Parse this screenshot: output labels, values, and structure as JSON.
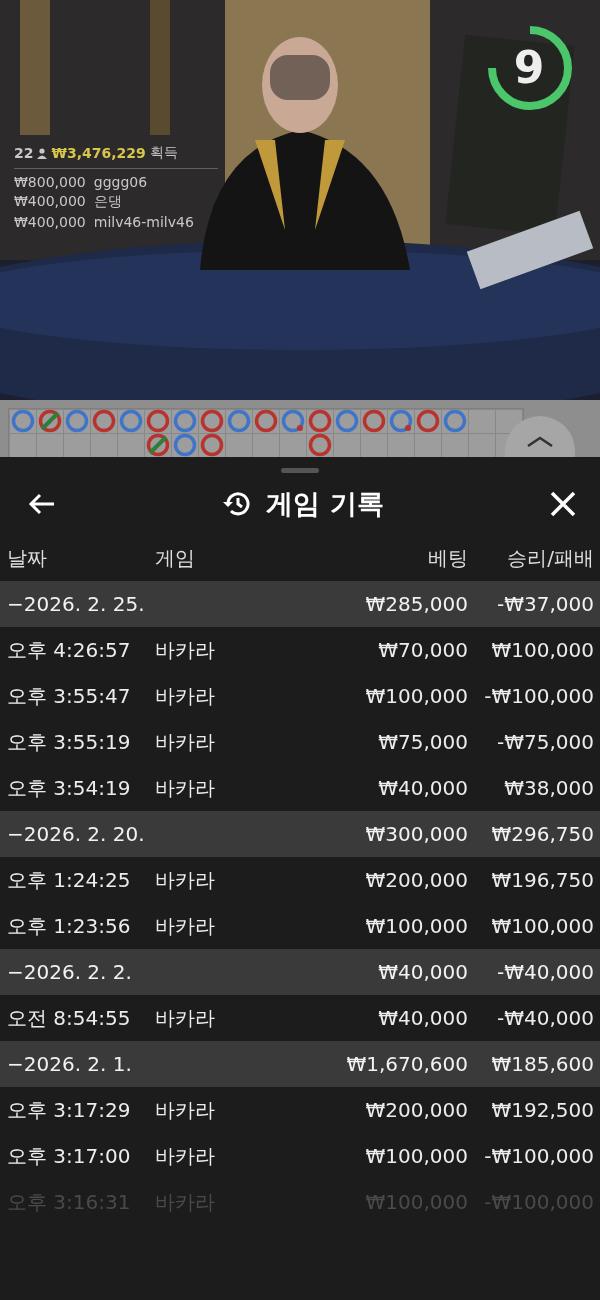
{
  "winners": {
    "count": "22",
    "total": "₩3,476,229",
    "suffix": "획득",
    "rows": [
      {
        "amount": "₩800,000",
        "name": "gggg06"
      },
      {
        "amount": "₩400,000",
        "name": "은댕"
      },
      {
        "amount": "₩400,000",
        "name": "milv46-milv46"
      }
    ]
  },
  "timer": {
    "text": "9",
    "level": 0.75
  },
  "bead_road": [
    {
      "cells": [
        {
          "kind": "circle",
          "color": "#3f74c8",
          "tie": false,
          "dot": false
        },
        {
          "kind": "circle",
          "color": "#b8322e",
          "tie": true,
          "dot": false
        },
        {
          "kind": "circle",
          "color": "#3f74c8",
          "tie": false,
          "dot": false
        },
        {
          "kind": "circle",
          "color": "#b8322e",
          "tie": false,
          "dot": false
        },
        {
          "kind": "circle",
          "color": "#3f74c8",
          "tie": false,
          "dot": false
        },
        {
          "kind": "circle",
          "color": "#b8322e",
          "tie": false,
          "dot": false
        },
        {
          "kind": "circle",
          "color": "#3f74c8",
          "tie": false,
          "dot": false
        },
        {
          "kind": "circle",
          "color": "#b8322e",
          "tie": false,
          "dot": false
        },
        {
          "kind": "circle",
          "color": "#3f74c8",
          "tie": false,
          "dot": false
        },
        {
          "kind": "circle",
          "color": "#b8322e",
          "tie": false,
          "dot": false
        },
        {
          "kind": "circle",
          "color": "#3f74c8",
          "tie": false,
          "dot": true
        },
        {
          "kind": "circle",
          "color": "#b8322e",
          "tie": false,
          "dot": false
        },
        {
          "kind": "circle",
          "color": "#3f74c8",
          "tie": false,
          "dot": false
        },
        {
          "kind": "circle",
          "color": "#b8322e",
          "tie": false,
          "dot": false
        },
        {
          "kind": "circle",
          "color": "#3f74c8",
          "tie": false,
          "dot": true
        },
        {
          "kind": "circle",
          "color": "#b8322e",
          "tie": false,
          "dot": false
        },
        {
          "kind": "circle",
          "color": "#3f74c8",
          "tie": false,
          "dot": false
        }
      ]
    },
    {
      "cells": [
        {
          "kind": "empty"
        },
        {
          "kind": "empty"
        },
        {
          "kind": "empty"
        },
        {
          "kind": "empty"
        },
        {
          "kind": "empty"
        },
        {
          "kind": "circle",
          "color": "#b8322e",
          "tie": true,
          "dot": false
        },
        {
          "kind": "circle",
          "color": "#3f74c8",
          "tie": false,
          "dot": false
        },
        {
          "kind": "circle",
          "color": "#b8322e",
          "tie": false,
          "dot": false
        },
        {
          "kind": "empty"
        },
        {
          "kind": "empty"
        },
        {
          "kind": "empty"
        },
        {
          "kind": "circle",
          "color": "#b8322e",
          "tie": false,
          "dot": false
        }
      ]
    }
  ],
  "sheet": {
    "title": "게임 기록",
    "columns": [
      "날짜",
      "게임",
      "베팅",
      "승리/패배"
    ],
    "rows": [
      {
        "kind": "date",
        "date": "−2026. 2. 25.",
        "bet": "₩285,000",
        "result": "-₩37,000"
      },
      {
        "kind": "game",
        "date": "오후 4:26:57",
        "game": "바카라",
        "bet": "₩70,000",
        "result": "₩100,000",
        "faded": false
      },
      {
        "kind": "game",
        "date": "오후 3:55:47",
        "game": "바카라",
        "bet": "₩100,000",
        "result": "-₩100,000",
        "faded": false
      },
      {
        "kind": "game",
        "date": "오후 3:55:19",
        "game": "바카라",
        "bet": "₩75,000",
        "result": "-₩75,000",
        "faded": false
      },
      {
        "kind": "game",
        "date": "오후 3:54:19",
        "game": "바카라",
        "bet": "₩40,000",
        "result": "₩38,000",
        "faded": false
      },
      {
        "kind": "date",
        "date": "−2026. 2. 20.",
        "bet": "₩300,000",
        "result": "₩296,750"
      },
      {
        "kind": "game",
        "date": "오후 1:24:25",
        "game": "바카라",
        "bet": "₩200,000",
        "result": "₩196,750",
        "faded": false
      },
      {
        "kind": "game",
        "date": "오후 1:23:56",
        "game": "바카라",
        "bet": "₩100,000",
        "result": "₩100,000",
        "faded": false
      },
      {
        "kind": "date",
        "date": "−2026. 2. 2.",
        "bet": "₩40,000",
        "result": "-₩40,000"
      },
      {
        "kind": "game",
        "date": "오전 8:54:55",
        "game": "바카라",
        "bet": "₩40,000",
        "result": "-₩40,000",
        "faded": false
      },
      {
        "kind": "date",
        "date": "−2026. 2. 1.",
        "bet": "₩1,670,600",
        "result": "₩185,600"
      },
      {
        "kind": "game",
        "date": "오후 3:17:29",
        "game": "바카라",
        "bet": "₩200,000",
        "result": "₩192,500",
        "faded": false
      },
      {
        "kind": "game",
        "date": "오후 3:17:00",
        "game": "바카라",
        "bet": "₩100,000",
        "result": "-₩100,000",
        "faded": false
      },
      {
        "kind": "game",
        "date": "오후 3:16:31",
        "game": "바카라",
        "bet": "₩100,000",
        "result": "-₩100,000",
        "faded": true
      }
    ]
  }
}
